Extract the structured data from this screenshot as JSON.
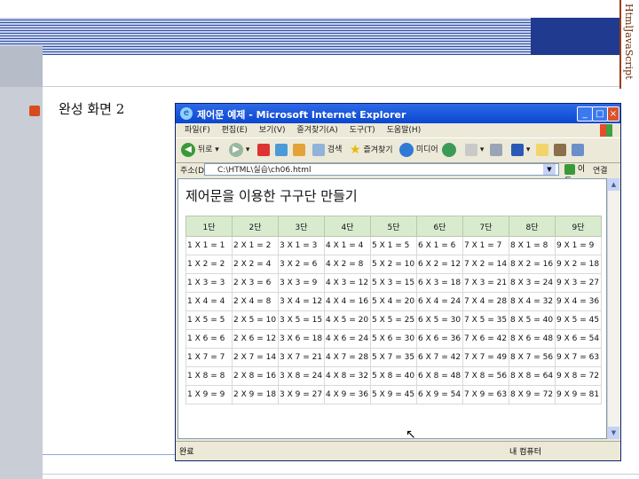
{
  "slide": {
    "side_title": "HtmlJavaScript",
    "section_title": "완성 화면 2"
  },
  "window": {
    "title": "제어문 예제 - Microsoft Internet Explorer",
    "menu": [
      "파일(F)",
      "편집(E)",
      "보기(V)",
      "즐겨찾기(A)",
      "도구(T)",
      "도움말(H)"
    ],
    "toolbar": {
      "back": "뒤로",
      "search": "검색",
      "favorites": "즐겨찾기",
      "media": "미디어"
    },
    "address_label": "주소(D)",
    "address_value": "C:\\HTML\\실습\\ch06.html",
    "go_label": "이동",
    "links_label": "연결",
    "status_left": "완료",
    "status_right": "내 컴퓨터"
  },
  "page": {
    "heading": "제어문을 이용한 구구단 만들기",
    "columns": [
      "1단",
      "2단",
      "3단",
      "4단",
      "5단",
      "6단",
      "7단",
      "8단",
      "9단"
    ],
    "rows": [
      [
        "1 X 1 = 1",
        "2 X 1 = 2",
        "3 X 1 = 3",
        "4 X 1 = 4",
        "5 X 1 = 5",
        "6 X 1 = 6",
        "7 X 1 = 7",
        "8 X 1 = 8",
        "9 X 1 = 9"
      ],
      [
        "1 X 2 = 2",
        "2 X 2 = 4",
        "3 X 2 = 6",
        "4 X 2 = 8",
        "5 X 2 = 10",
        "6 X 2 = 12",
        "7 X 2 = 14",
        "8 X 2 = 16",
        "9 X 2 = 18"
      ],
      [
        "1 X 3 = 3",
        "2 X 3 = 6",
        "3 X 3 = 9",
        "4 X 3 = 12",
        "5 X 3 = 15",
        "6 X 3 = 18",
        "7 X 3 = 21",
        "8 X 3 = 24",
        "9 X 3 = 27"
      ],
      [
        "1 X 4 = 4",
        "2 X 4 = 8",
        "3 X 4 = 12",
        "4 X 4 = 16",
        "5 X 4 = 20",
        "6 X 4 = 24",
        "7 X 4 = 28",
        "8 X 4 = 32",
        "9 X 4 = 36"
      ],
      [
        "1 X 5 = 5",
        "2 X 5 = 10",
        "3 X 5 = 15",
        "4 X 5 = 20",
        "5 X 5 = 25",
        "6 X 5 = 30",
        "7 X 5 = 35",
        "8 X 5 = 40",
        "9 X 5 = 45"
      ],
      [
        "1 X 6 = 6",
        "2 X 6 = 12",
        "3 X 6 = 18",
        "4 X 6 = 24",
        "5 X 6 = 30",
        "6 X 6 = 36",
        "7 X 6 = 42",
        "8 X 6 = 48",
        "9 X 6 = 54"
      ],
      [
        "1 X 7 = 7",
        "2 X 7 = 14",
        "3 X 7 = 21",
        "4 X 7 = 28",
        "5 X 7 = 35",
        "6 X 7 = 42",
        "7 X 7 = 49",
        "8 X 7 = 56",
        "9 X 7 = 63"
      ],
      [
        "1 X 8 = 8",
        "2 X 8 = 16",
        "3 X 8 = 24",
        "4 X 8 = 32",
        "5 X 8 = 40",
        "6 X 8 = 48",
        "7 X 8 = 56",
        "8 X 8 = 64",
        "9 X 8 = 72"
      ],
      [
        "1 X 9 = 9",
        "2 X 9 = 18",
        "3 X 9 = 27",
        "4 X 9 = 36",
        "5 X 9 = 45",
        "6 X 9 = 54",
        "7 X 9 = 63",
        "8 X 9 = 72",
        "9 X 9 = 81"
      ]
    ]
  },
  "colors": {
    "header_band": "#2f4fa3",
    "bullet": "#d94a1e",
    "table_header": "#d8ebcf",
    "titlebar": "#0b47cf"
  }
}
